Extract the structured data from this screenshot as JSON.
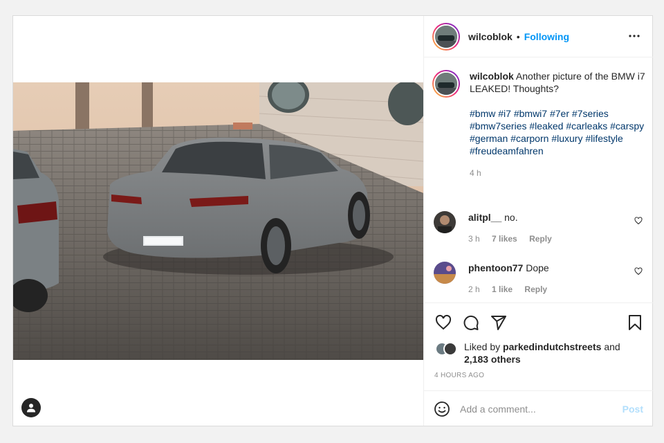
{
  "post": {
    "username": "wilcoblok",
    "separator": "•",
    "follow_label": "Following",
    "more_icon": "more-horizontal-icon",
    "photo_alt": "Grey BMW i7 sedan parked on cobblestones"
  },
  "caption": {
    "username": "wilcoblok",
    "text": "Another picture of the BMW i7 LEAKED! Thoughts?",
    "hashtags": [
      "#bmw",
      "#i7",
      "#bmwi7",
      "#7er",
      "#7series",
      "#bmw7series",
      "#leaked",
      "#carleaks",
      "#carspy",
      "#german",
      "#carporn",
      "#luxury",
      "#lifestyle",
      "#freudeamfahren"
    ],
    "time": "4 h"
  },
  "comments": [
    {
      "username": "alitpl__",
      "text": "no.",
      "time": "3 h",
      "likes": "7 likes",
      "reply": "Reply"
    },
    {
      "username": "phentoon77",
      "text": "Dope",
      "time": "2 h",
      "likes": "1 like",
      "reply": "Reply"
    }
  ],
  "likes": {
    "prefix": "Liked by",
    "user": "parkedindutchstreets",
    "middle": "and",
    "others": "2,183 others"
  },
  "timestamp": "4 HOURS AGO",
  "add_comment": {
    "placeholder": "Add a comment...",
    "post_label": "Post"
  },
  "colors": {
    "accent": "#0095f6",
    "post_disabled": "#b2dffc",
    "muted": "#8e8e8e"
  }
}
